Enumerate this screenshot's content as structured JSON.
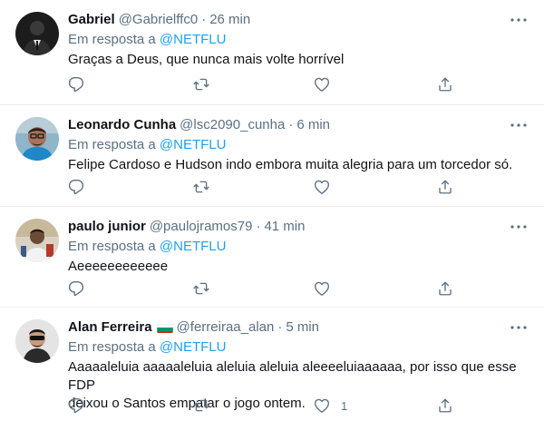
{
  "colors": {
    "text": "#0f1419",
    "secondary": "#5b7083",
    "link": "#1da1f2",
    "divider": "#ebeef0"
  },
  "icons": {
    "more": "more-dots-icon",
    "reply": "reply-bubble-icon",
    "retweet": "retweet-icon",
    "like": "heart-icon",
    "share": "share-upload-icon"
  },
  "tweets": [
    {
      "name": "Gabriel",
      "handle": "@Gabrielffc0",
      "separator": "·",
      "time": "26 min",
      "reply_prefix": "Em resposta a",
      "reply_to": "@NETFLU",
      "text": "Graças a Deus, que nunca mais volte horrível",
      "likes": ""
    },
    {
      "name": "Leonardo Cunha",
      "handle": "@lsc2090_cunha",
      "separator": "·",
      "time": "6 min",
      "reply_prefix": "Em resposta a",
      "reply_to": "@NETFLU",
      "text": "Felipe Cardoso e Hudson indo embora muita alegria para um torcedor só.",
      "likes": ""
    },
    {
      "name": "paulo junior",
      "handle": "@paulojramos79",
      "separator": "·",
      "time": "41 min",
      "reply_prefix": "Em resposta a",
      "reply_to": "@NETFLU",
      "text": "Aeeeeeeeeeeee",
      "likes": ""
    },
    {
      "name": "Alan Ferreira",
      "flag": "bulgaria-flag-emoji",
      "handle": "@ferreiraa_alan",
      "separator": "·",
      "time": "5 min",
      "reply_prefix": "Em resposta a",
      "reply_to": "@NETFLU",
      "text_line1": "Aaaaaleluia aaaaaleluia aleluia aleluia aleeeeluiaaaaaa, por isso que esse FDP",
      "text_line2": "deixou o Santos empatar o jogo ontem.",
      "likes": "1"
    }
  ]
}
